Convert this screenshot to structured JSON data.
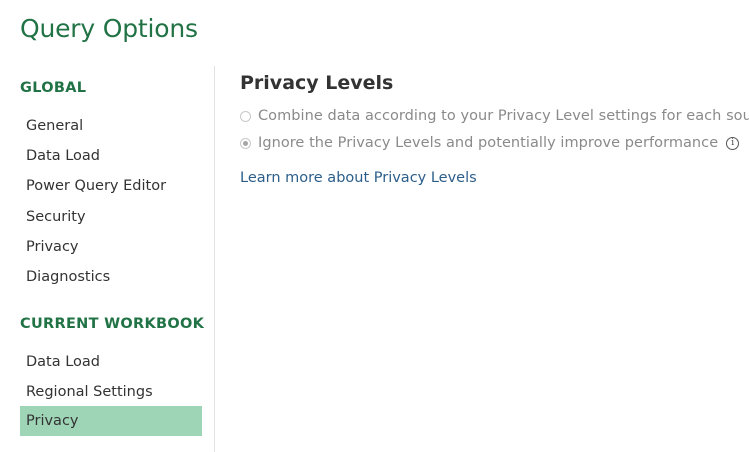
{
  "dialog": {
    "title": "Query Options"
  },
  "sidebar": {
    "global_header": "GLOBAL",
    "global_items": [
      {
        "label": "General"
      },
      {
        "label": "Data Load"
      },
      {
        "label": "Power Query Editor"
      },
      {
        "label": "Security"
      },
      {
        "label": "Privacy"
      },
      {
        "label": "Diagnostics"
      }
    ],
    "workbook_header": "CURRENT WORKBOOK",
    "workbook_items": [
      {
        "label": "Data Load"
      },
      {
        "label": "Regional Settings"
      },
      {
        "label": "Privacy",
        "selected": true
      }
    ],
    "selected_color": "#9fd5b7"
  },
  "content": {
    "title": "Privacy Levels",
    "options": [
      {
        "label": "Combine data according to your Privacy Level settings for each source",
        "checked": false,
        "disabled": true
      },
      {
        "label": "Ignore the Privacy Levels and potentially improve performance",
        "checked": true,
        "disabled": true,
        "info_icon": "info-icon"
      }
    ],
    "learn_more_link": "Learn more about Privacy Levels"
  },
  "colors": {
    "accent": "#217346",
    "link": "#2c5e8a"
  }
}
